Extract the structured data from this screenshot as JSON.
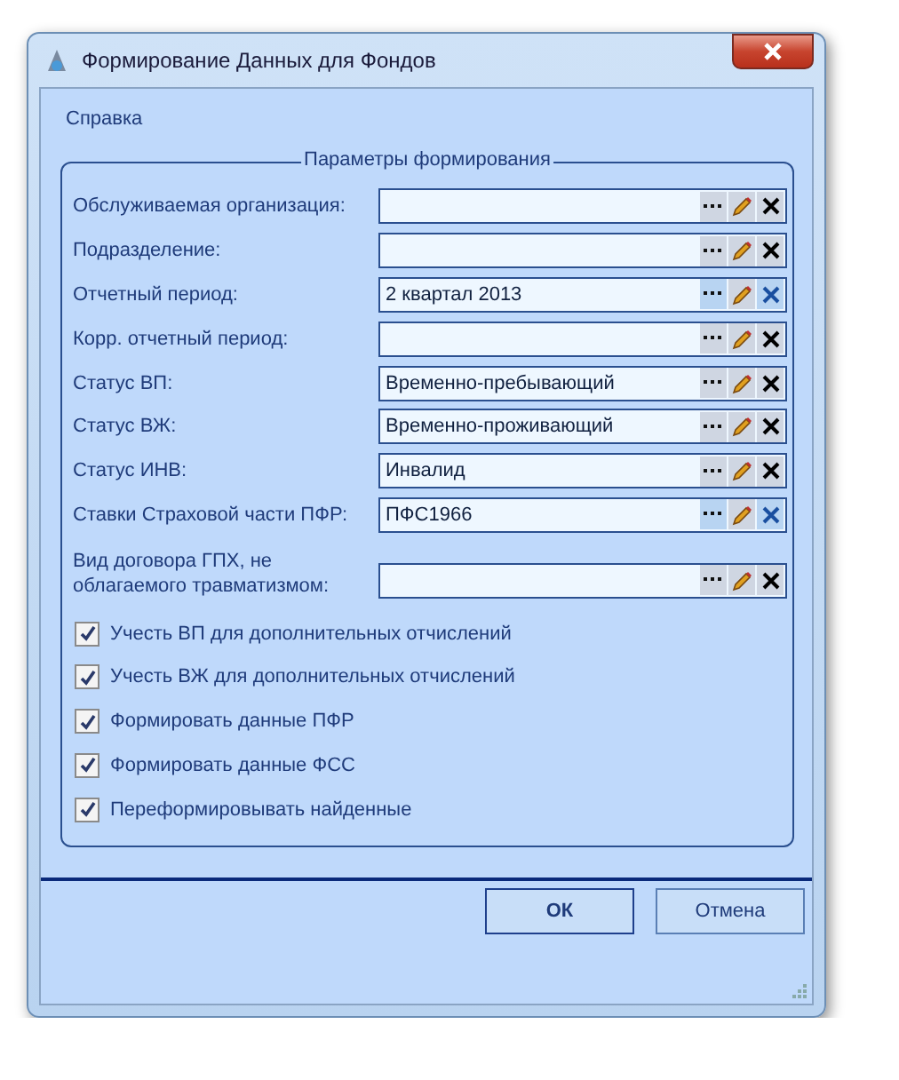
{
  "window": {
    "title": "Формирование Данных для Фондов"
  },
  "menu": [
    "Справка"
  ],
  "group": {
    "title": "Параметры формирования",
    "fields": [
      {
        "label": "Обслуживаемая организация:",
        "highlighted": false
      },
      {
        "label": "Подразделение:",
        "highlighted": false
      },
      {
        "label": "Отчетный период:",
        "value": "2 квартал 2013",
        "highlighted": true
      },
      {
        "label": "Корр. отчетный период:",
        "highlighted": false
      },
      {
        "label": "Статус ВП:",
        "value": "Временно-пребывающий",
        "highlighted": false
      },
      {
        "label": "Статус ВЖ:",
        "value": "Временно-проживающий",
        "highlighted": false
      },
      {
        "label": "Статус ИНВ:",
        "value": "Инвалид",
        "highlighted": false
      },
      {
        "label": "Ставки Страховой части ПФР:",
        "value": "ПФС1966",
        "highlighted": true
      },
      {
        "label": "Вид договора ГПХ, не облагаемого травматизмом:",
        "highlighted": false
      }
    ],
    "checkboxes": [
      {
        "label": "Учесть ВП для дополнительных отчислений",
        "checked": true
      },
      {
        "label": "Учесть ВЖ для дополнительных отчислений",
        "checked": true
      },
      {
        "label": "Формировать данные ПФР",
        "checked": true
      },
      {
        "label": "Формировать данные ФСС",
        "checked": true
      },
      {
        "label": "Переформировывать найденные",
        "checked": true
      }
    ]
  },
  "buttons": [
    {
      "label": "ОК",
      "default": true
    },
    {
      "label": "Отмена",
      "default": false
    }
  ]
}
